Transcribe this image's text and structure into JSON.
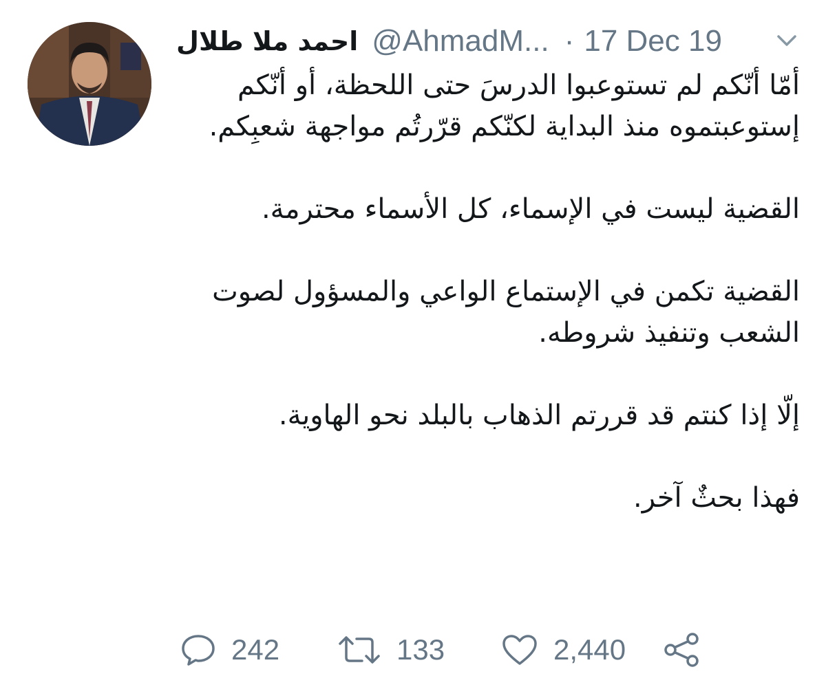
{
  "tweet": {
    "display_name": "احمد ملا طلال",
    "handle": "@AhmadM...",
    "separator": "·",
    "date": "17 Dec 19",
    "paragraphs": [
      "أمّا أنّكم لم تستوعبوا الدرسَ حتى اللحظة، أو أنّكم إستوعبتموه منذ البداية لكنّكم قرّرتُم مواجهة شعبِكم.",
      "القضية ليست في الإسماء، كل الأسماء محترمة.",
      "القضية تكمن في الإستماع الواعي والمسؤول لصوت الشعب وتنفيذ شروطه.",
      "إلّا إذا كنتم قد قررتم الذهاب بالبلد نحو الهاوية.",
      "فهذا بحثٌ آخر."
    ],
    "actions": {
      "reply_count": "242",
      "retweet_count": "133",
      "like_count": "2,440"
    },
    "icons": {
      "reply": "reply-icon",
      "retweet": "retweet-icon",
      "like": "heart-icon",
      "share": "share-icon",
      "caret": "chevron-down-icon"
    },
    "colors": {
      "text": "#14171a",
      "secondary": "#657786"
    }
  }
}
